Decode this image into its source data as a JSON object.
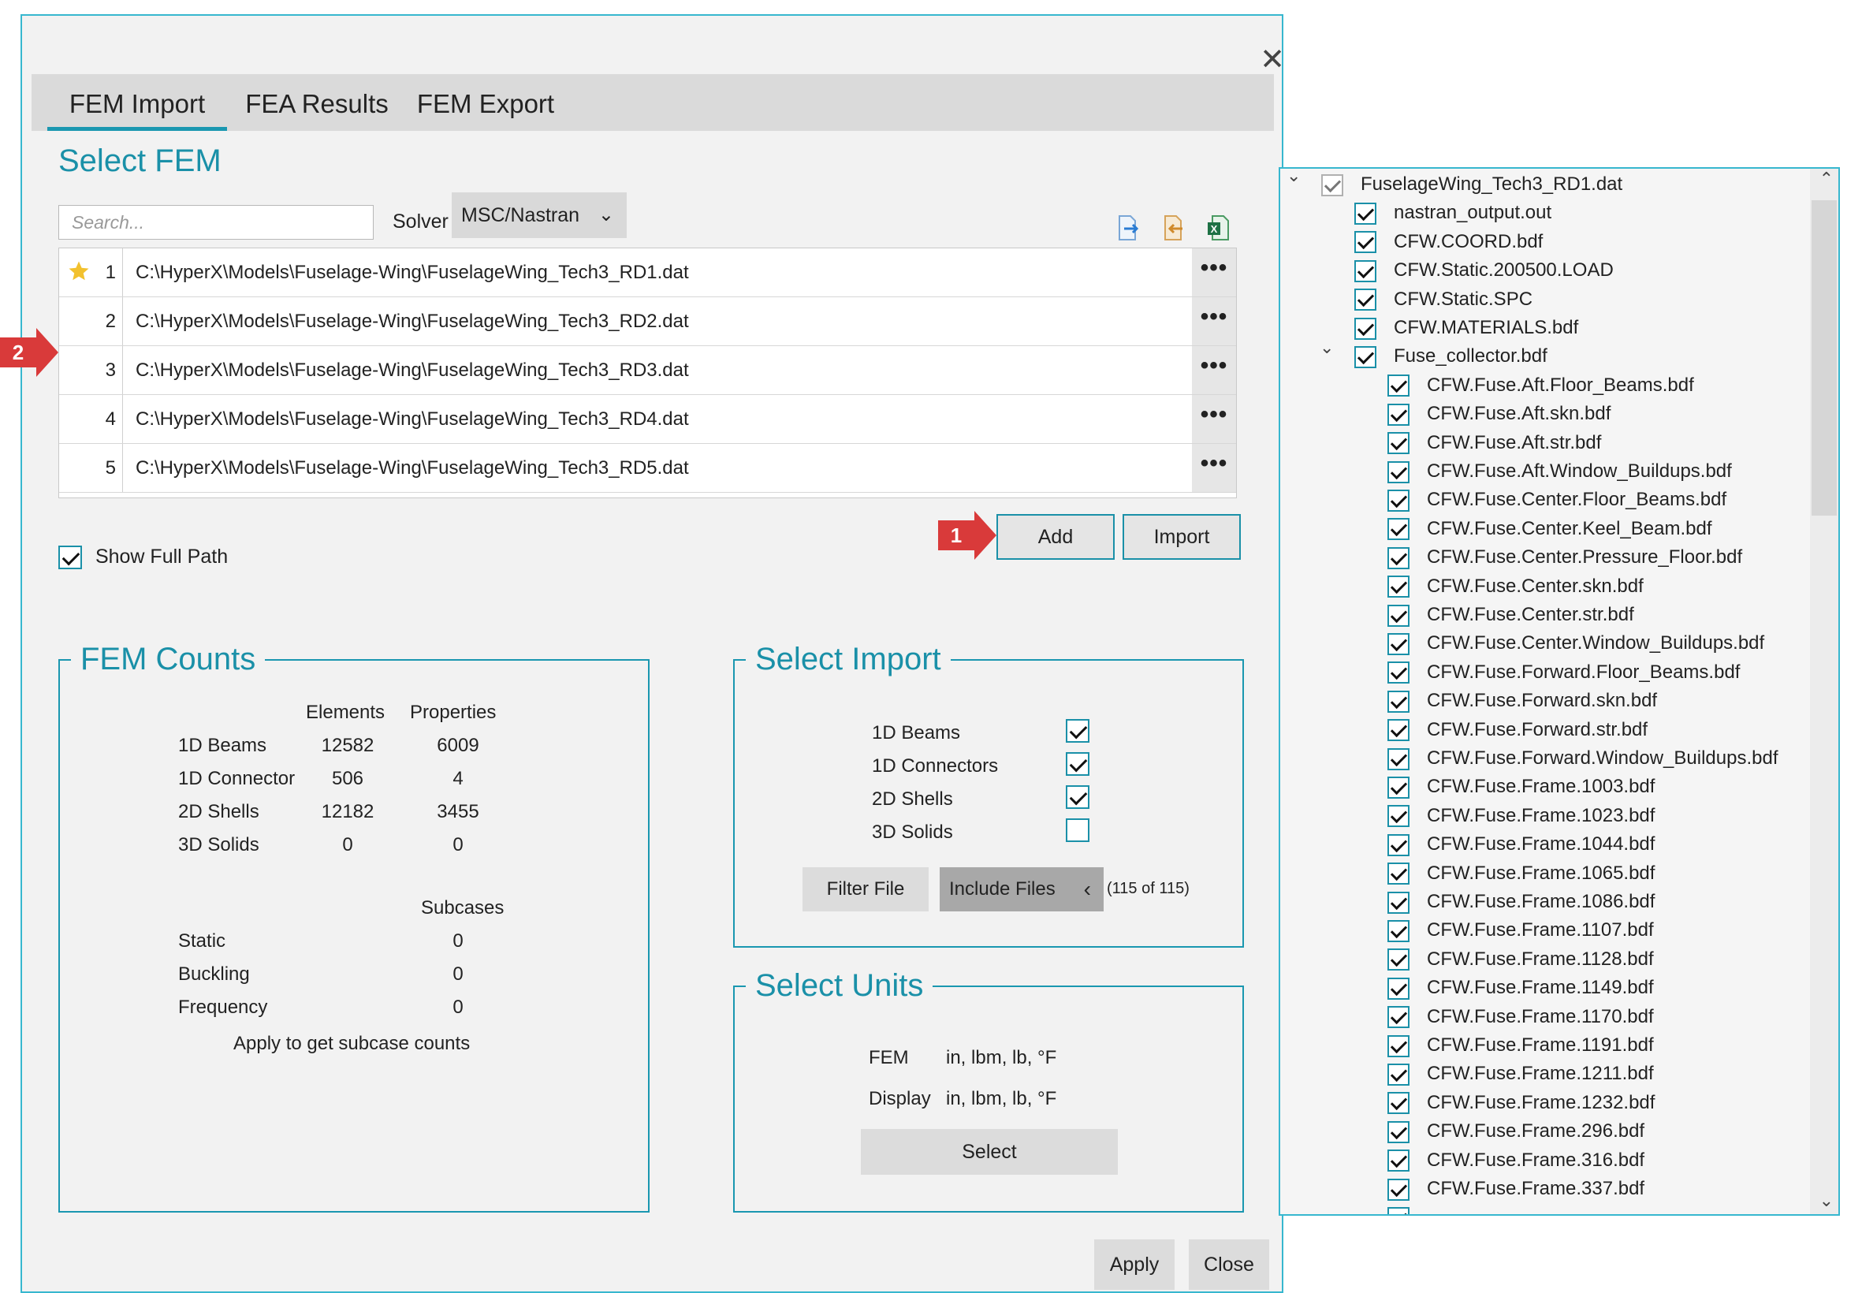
{
  "dialog": {
    "close_glyph": "✕",
    "tabs": [
      "FEM Import",
      "FEA Results",
      "FEM Export"
    ],
    "active_tab": "FEM Import",
    "select_fem_title": "Select FEM",
    "search_placeholder": "Search...",
    "solver_label": "Solver",
    "solver_value": "MSC/Nastran",
    "toolbar_icons": [
      "export-icon",
      "import-icon",
      "excel-icon"
    ],
    "files": [
      {
        "num": "1",
        "path": "C:\\HyperX\\Models\\Fuselage-Wing\\FuselageWing_Tech3_RD1.dat",
        "starred": true
      },
      {
        "num": "2",
        "path": "C:\\HyperX\\Models\\Fuselage-Wing\\FuselageWing_Tech3_RD2.dat",
        "starred": false
      },
      {
        "num": "3",
        "path": "C:\\HyperX\\Models\\Fuselage-Wing\\FuselageWing_Tech3_RD3.dat",
        "starred": false
      },
      {
        "num": "4",
        "path": "C:\\HyperX\\Models\\Fuselage-Wing\\FuselageWing_Tech3_RD4.dat",
        "starred": false
      },
      {
        "num": "5",
        "path": "C:\\HyperX\\Models\\Fuselage-Wing\\FuselageWing_Tech3_RD5.dat",
        "starred": false
      }
    ],
    "more_glyph": "•••",
    "show_full_path_label": "Show Full Path",
    "show_full_path_checked": true,
    "add_label": "Add",
    "import_label": "Import",
    "callouts": {
      "one": "1",
      "two": "2"
    },
    "fem_counts": {
      "title": "FEM Counts",
      "col_elements": "Elements",
      "col_properties": "Properties",
      "rows": [
        {
          "label": "1D Beams",
          "elements": "12582",
          "properties": "6009"
        },
        {
          "label": "1D Connector",
          "elements": "506",
          "properties": "4"
        },
        {
          "label": "2D Shells",
          "elements": "12182",
          "properties": "3455"
        },
        {
          "label": "3D Solids",
          "elements": "0",
          "properties": "0"
        }
      ],
      "subcases_header": "Subcases",
      "subcases": [
        {
          "label": "Static",
          "value": "0"
        },
        {
          "label": "Buckling",
          "value": "0"
        },
        {
          "label": "Frequency",
          "value": "0"
        }
      ],
      "note": "Apply to get subcase counts"
    },
    "select_import": {
      "title": "Select Import",
      "items": [
        {
          "label": "1D Beams",
          "checked": true
        },
        {
          "label": "1D Connectors",
          "checked": true
        },
        {
          "label": "2D Shells",
          "checked": true
        },
        {
          "label": "3D Solids",
          "checked": false
        }
      ],
      "filter_file_label": "Filter File",
      "include_files_label": "Include Files",
      "include_chevron": "‹",
      "include_count": "(115 of 115)"
    },
    "select_units": {
      "title": "Select Units",
      "fem_label": "FEM",
      "fem_value": "in, lbm, lb, °F",
      "display_label": "Display",
      "display_value": "in, lbm, lb, °F",
      "select_label": "Select"
    },
    "apply_label": "Apply",
    "close_label": "Close"
  },
  "tree": {
    "root": "FuselageWing_Tech3_RD1.dat",
    "top_items": [
      "nastran_output.out",
      "CFW.COORD.bdf",
      "CFW.Static.200500.LOAD",
      "CFW.Static.SPC",
      "CFW.MATERIALS.bdf"
    ],
    "collector": "Fuse_collector.bdf",
    "children": [
      "CFW.Fuse.Aft.Floor_Beams.bdf",
      "CFW.Fuse.Aft.skn.bdf",
      "CFW.Fuse.Aft.str.bdf",
      "CFW.Fuse.Aft.Window_Buildups.bdf",
      "CFW.Fuse.Center.Floor_Beams.bdf",
      "CFW.Fuse.Center.Keel_Beam.bdf",
      "CFW.Fuse.Center.Pressure_Floor.bdf",
      "CFW.Fuse.Center.skn.bdf",
      "CFW.Fuse.Center.str.bdf",
      "CFW.Fuse.Center.Window_Buildups.bdf",
      "CFW.Fuse.Forward.Floor_Beams.bdf",
      "CFW.Fuse.Forward.skn.bdf",
      "CFW.Fuse.Forward.str.bdf",
      "CFW.Fuse.Forward.Window_Buildups.bdf",
      "CFW.Fuse.Frame.1003.bdf",
      "CFW.Fuse.Frame.1023.bdf",
      "CFW.Fuse.Frame.1044.bdf",
      "CFW.Fuse.Frame.1065.bdf",
      "CFW.Fuse.Frame.1086.bdf",
      "CFW.Fuse.Frame.1107.bdf",
      "CFW.Fuse.Frame.1128.bdf",
      "CFW.Fuse.Frame.1149.bdf",
      "CFW.Fuse.Frame.1170.bdf",
      "CFW.Fuse.Frame.1191.bdf",
      "CFW.Fuse.Frame.1211.bdf",
      "CFW.Fuse.Frame.1232.bdf",
      "CFW.Fuse.Frame.296.bdf",
      "CFW.Fuse.Frame.316.bdf",
      "CFW.Fuse.Frame.337.bdf"
    ],
    "expand_glyph": "⌄",
    "scroll_up": "⌃",
    "scroll_down": "⌄"
  },
  "colors": {
    "accent": "#1a97b0",
    "callout": "#d93a3a",
    "panel": "#f2f2f2"
  }
}
